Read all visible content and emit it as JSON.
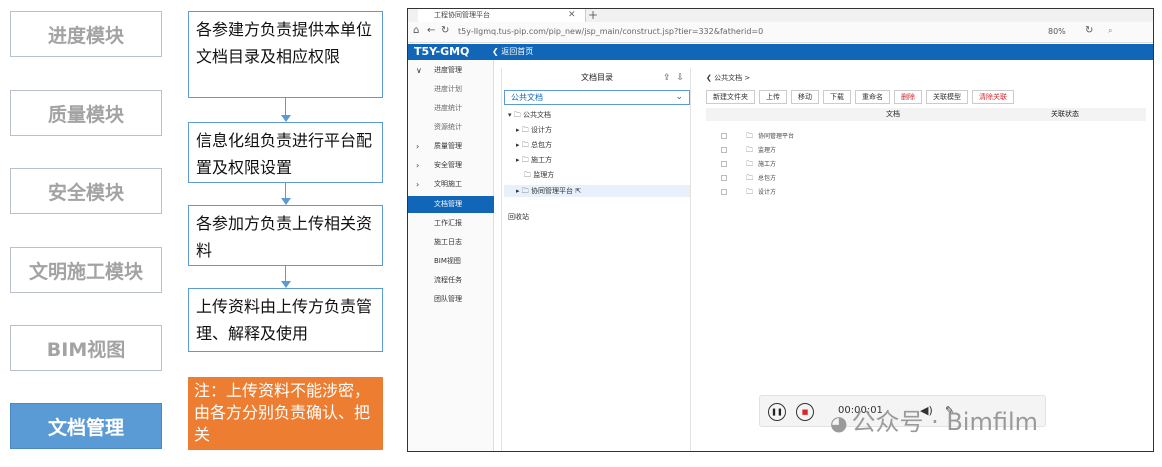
{
  "modules": [
    {
      "label": "进度模块",
      "active": false
    },
    {
      "label": "质量模块",
      "active": false
    },
    {
      "label": "安全模块",
      "active": false
    },
    {
      "label": "文明施工模块",
      "active": false
    },
    {
      "label": "BIM视图",
      "active": false
    },
    {
      "label": "文档管理",
      "active": true
    }
  ],
  "flow": [
    "各参建方负责提供本单位文档目录及相应权限",
    "信息化组负责进行平台配置及权限设置",
    "各参加方负责上传相关资料",
    "上传资料由上传方负责管理、解释及使用"
  ],
  "note": "注：上传资料不能涉密，由各方分别负责确认、把关",
  "browser": {
    "tab_title": "工程协同管理平台",
    "url": "t5y-llgmq.tus-pip.com/pip_new/jsp_main/construct.jsp?tier=332&fatherid=0",
    "zoom": "80%"
  },
  "app": {
    "brand": "T5Y-GMQ",
    "back_label": "返回首页",
    "nav": [
      {
        "label": "进度管理",
        "type": "group",
        "chev": "∨"
      },
      {
        "label": "进度计划",
        "type": "sub"
      },
      {
        "label": "进度统计",
        "type": "sub"
      },
      {
        "label": "资源统计",
        "type": "sub"
      },
      {
        "label": "质量管理",
        "type": "group",
        "chev": "›"
      },
      {
        "label": "安全管理",
        "type": "group",
        "chev": "›"
      },
      {
        "label": "文明施工",
        "type": "group",
        "chev": "›"
      },
      {
        "label": "文档管理",
        "type": "active"
      },
      {
        "label": "工作汇报",
        "type": "plain"
      },
      {
        "label": "施工日志",
        "type": "plain"
      },
      {
        "label": "BIM视图",
        "type": "plain"
      },
      {
        "label": "流程任务",
        "type": "plain"
      },
      {
        "label": "团队管理",
        "type": "plain"
      }
    ],
    "tree": {
      "title": "文档目录",
      "select": "公共文档",
      "root": "公共文档",
      "children": [
        "设计方",
        "总包方",
        "施工方",
        "监理方",
        "协同管理平台"
      ],
      "recycle": "回收站"
    },
    "content": {
      "breadcrumb": "公共文档 >",
      "toolbar": [
        "新建文件夹",
        "上传",
        "移动",
        "下载",
        "重命名",
        "删除",
        "关联模型",
        "清除关联"
      ],
      "columns": [
        "文档",
        "关联状态"
      ],
      "rows": [
        "协同管理平台",
        "监理方",
        "施工方",
        "总包方",
        "设计方"
      ]
    },
    "player": {
      "time": "00:00:01"
    }
  },
  "watermark": "公众号 · Bimfilm",
  "colors": {
    "accent": "#5b9bd5",
    "note": "#ed7d31",
    "app_blue": "#1266b8",
    "danger": "#d9262a"
  }
}
